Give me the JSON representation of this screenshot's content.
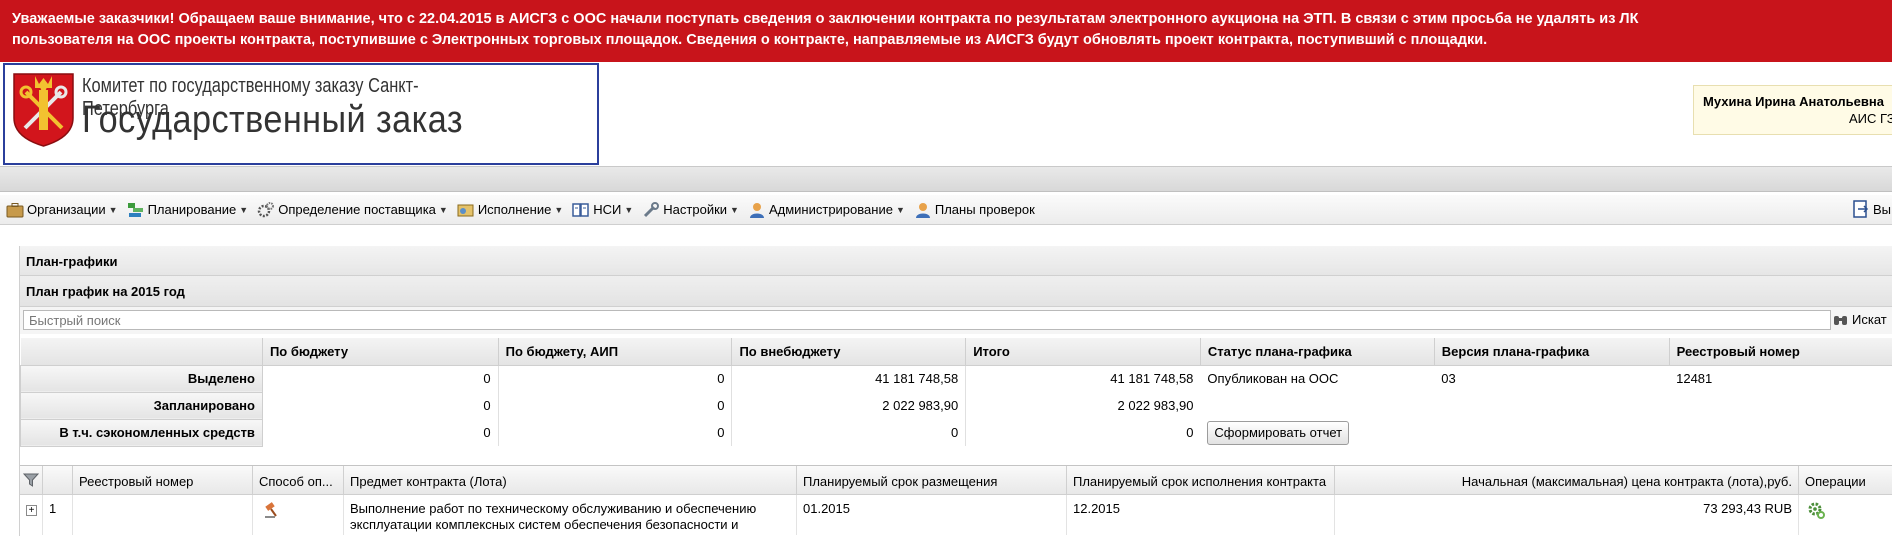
{
  "notice": {
    "line1": "Уважаемые заказчики! Обращаем ваше внимание, что с 22.04.2015 в АИСГЗ с ООС начали поступать сведения о заключении контракта по результатам электронного аукциона на ЭТП. В связи с этим просьба не удалять из ЛК",
    "line2": "пользователя на ООС проекты контракта, поступившие с Электронных торговых площадок. Сведения о контракте, направляемые из АИСГЗ будут обновлять проект контракта, поступивший с площадки."
  },
  "logo": {
    "line1": "Комитет по государственному заказу Санкт-Петербурга",
    "line2": "Государственный заказ",
    "emblem_icon": "spb-coat-of-arms-icon"
  },
  "user": {
    "name": "Мухина Ирина Анатольевна",
    "org": "АИС ГЗ"
  },
  "menu": {
    "items": [
      {
        "label": "Организации",
        "icon": "briefcase-icon",
        "dropdown": true
      },
      {
        "label": "Планирование",
        "icon": "planning-icon",
        "dropdown": true
      },
      {
        "label": "Определение поставщика",
        "icon": "gears-icon",
        "dropdown": true
      },
      {
        "label": "Исполнение",
        "icon": "execution-icon",
        "dropdown": true
      },
      {
        "label": "НСИ",
        "icon": "book-icon",
        "dropdown": true
      },
      {
        "label": "Настройки",
        "icon": "wrench-icon",
        "dropdown": true
      },
      {
        "label": "Администрирование",
        "icon": "user-icon",
        "dropdown": true
      },
      {
        "label": "Планы проверок",
        "icon": "user-icon",
        "dropdown": false
      }
    ],
    "exit_label": "Вы"
  },
  "panel": {
    "title": "План-графики",
    "subtitle": "План график на 2015 год"
  },
  "search": {
    "placeholder": "Быстрый поиск",
    "button_label": "Искат"
  },
  "summary": {
    "headers": [
      "По бюджету",
      "По бюджету, АИП",
      "По внебюджету",
      "Итого",
      "Статус плана-графика",
      "Версия плана-графика",
      "Реестровый номер"
    ],
    "rows": [
      {
        "label": "Выделено",
        "values": [
          "0",
          "0",
          "41 181 748,58",
          "41 181 748,58"
        ],
        "status": "Опубликован на ООС",
        "version": "03",
        "reg": "12481"
      },
      {
        "label": "Запланировано",
        "values": [
          "0",
          "0",
          "2 022 983,90",
          "2 022 983,90"
        ],
        "status": "",
        "version": "",
        "reg": ""
      },
      {
        "label": "В т.ч. сэкономленных средств",
        "values": [
          "0",
          "0",
          "0",
          "0"
        ],
        "status": "",
        "version": "",
        "reg": ""
      }
    ],
    "report_button": "Сформировать отчет"
  },
  "grid": {
    "headers": [
      "Реестровый номер",
      "Способ оп...",
      "Предмет контракта (Лота)",
      "Планируемый срок размещения",
      "Планируемый срок исполнения контракта",
      "Начальная (максимальная) цена контракта (лота),руб.",
      "Операции"
    ],
    "rows": [
      {
        "index": "1",
        "reg": "",
        "subject": "Выполнение работ по техническому обслуживанию и обеспечению эксплуатации комплексных систем обеспечения безопасности и",
        "placement": "01.2015",
        "execution": "12.2015",
        "price": "73 293,43 RUB"
      }
    ]
  },
  "colors": {
    "notice_bg": "#c8141b",
    "logo_border": "#2b3f9c",
    "user_box_bg": "#fffbe6"
  }
}
